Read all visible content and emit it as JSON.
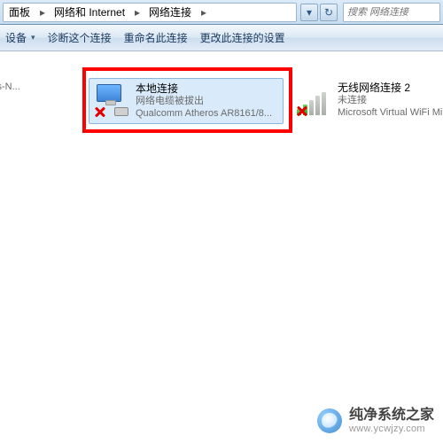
{
  "breadcrumb": {
    "items": [
      "面板",
      "网络和 Internet",
      "网络连接"
    ]
  },
  "search": {
    "placeholder": "搜索 网络连接"
  },
  "toolbar": {
    "organize": "设备",
    "diagnose": "诊断这个连接",
    "rename": "重命名此连接",
    "change": "更改此连接的设置"
  },
  "connections": [
    {
      "title": "",
      "status": "",
      "device": "ntrino(R) Wireless-N..."
    },
    {
      "title": "本地连接",
      "status": "网络电缆被拔出",
      "device": "Qualcomm Atheros AR8161/8..."
    },
    {
      "title": "无线网络连接 2",
      "status": "未连接",
      "device": "Microsoft Virtual WiFi Minip"
    }
  ],
  "watermark": {
    "title": "纯净系统之家",
    "url": "www.ycwjzy.com"
  }
}
